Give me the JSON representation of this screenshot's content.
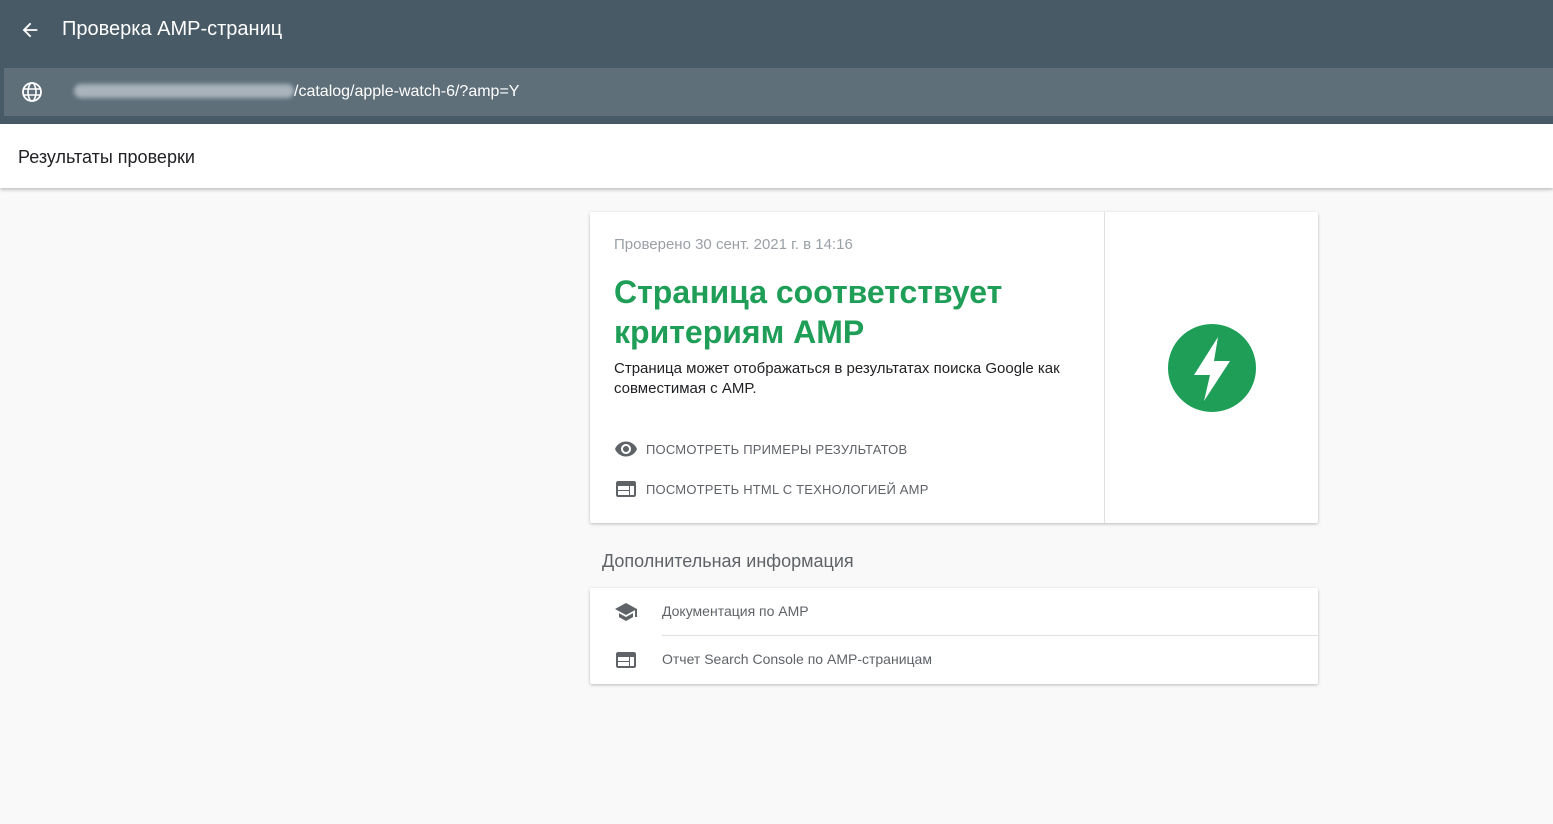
{
  "header": {
    "title": "Проверка AMP-страниц",
    "back_icon": "arrow-back-icon"
  },
  "urlbar": {
    "icon": "globe-icon",
    "url_visible": "/catalog/apple-watch-6/?amp=Y"
  },
  "results": {
    "title": "Результаты проверки"
  },
  "verdict_card": {
    "checked": "Проверено 30 сент. 2021 г. в 14:16",
    "heading": "Страница соответствует критериям AMP",
    "description": "Страница может отображаться в результатах поиска Google как совместимая с AMP.",
    "actions": [
      {
        "label": "ПОСМОТРЕТЬ ПРИМЕРЫ РЕЗУЛЬТАТОВ",
        "icon": "eye-icon"
      },
      {
        "label": "ПОСМОТРЕТЬ HTML С ТЕХНОЛОГИЕЙ AMP",
        "icon": "web-icon"
      }
    ],
    "logo": "amp-lightning-icon",
    "accent_color": "#1e9e57"
  },
  "additional": {
    "title": "Дополнительная информация",
    "items": [
      {
        "label": "Документация по AMP",
        "icon": "school-icon"
      },
      {
        "label": "Отчет Search Console по AMP-страницам",
        "icon": "web-icon"
      }
    ]
  }
}
